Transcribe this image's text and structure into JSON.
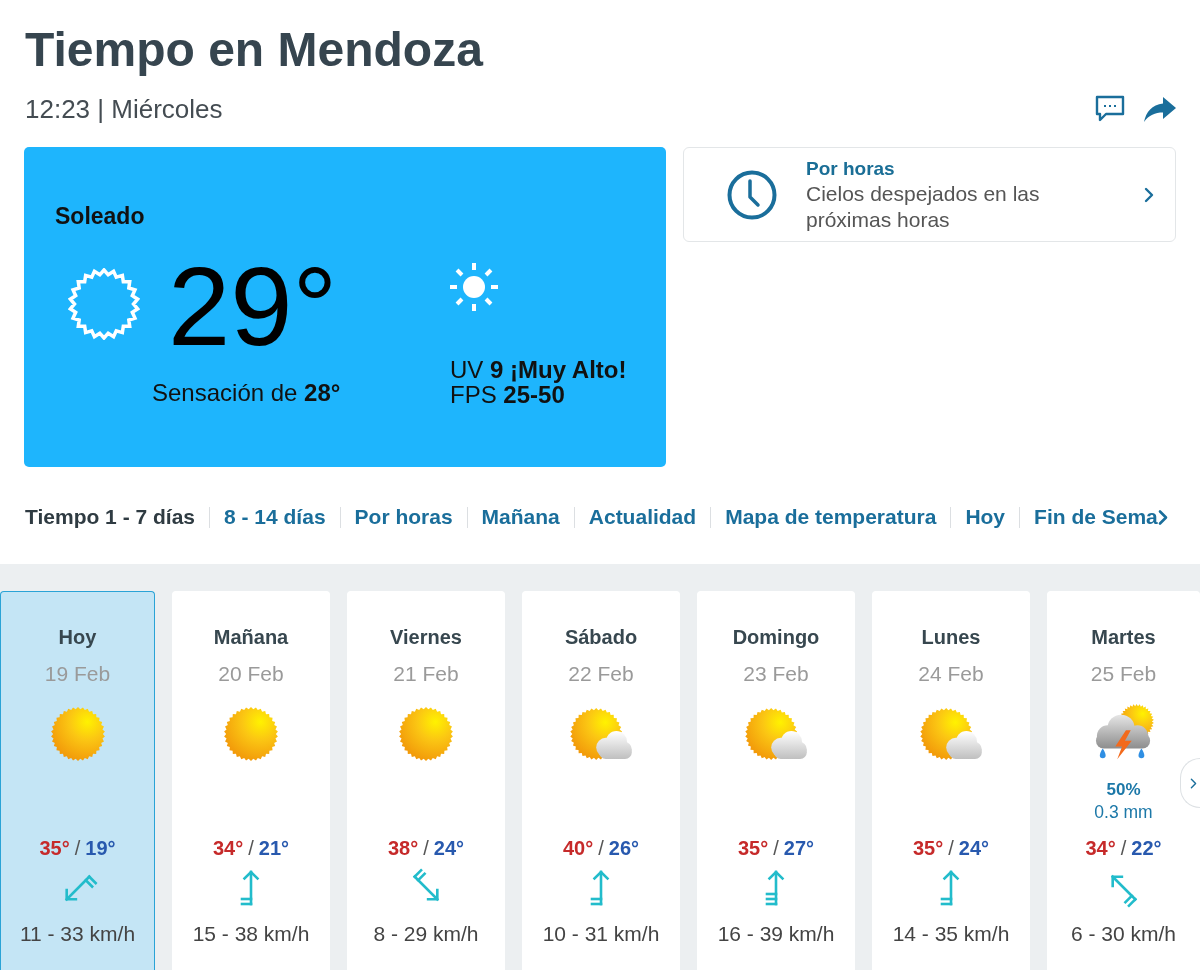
{
  "header": {
    "title": "Tiempo en Mendoza",
    "subtitle": "12:23 | Miércoles"
  },
  "current": {
    "condition": "Soleado",
    "temperature": "29°",
    "feels_like": "Sensación de **28°**",
    "uv": "UV **9 ¡Muy Alto!**",
    "fps": "FPS **25-50**"
  },
  "hourly_card": {
    "title": "Por horas",
    "text": "Cielos despejados en las próximas horas"
  },
  "nav_tabs": [
    {
      "label": "Tiempo 1 - 7 días",
      "selected": true
    },
    {
      "label": "8 - 14 días",
      "selected": false
    },
    {
      "label": "Por horas",
      "selected": false
    },
    {
      "label": "Mañana",
      "selected": false
    },
    {
      "label": "Actualidad",
      "selected": false
    },
    {
      "label": "Mapa de temperatura",
      "selected": false
    },
    {
      "label": "Hoy",
      "selected": false
    },
    {
      "label": "Fin de Sema",
      "selected": false
    }
  ],
  "days": [
    {
      "day": "Hoy",
      "date": "19 Feb",
      "kind": "sunny",
      "max": "35°",
      "separator": "/",
      "min": "19°",
      "wind_arrow": {
        "kind": "southwest",
        "strong": false
      },
      "wind": "11 - 33 km/h",
      "selected": true
    },
    {
      "day": "Mañana",
      "date": "20 Feb",
      "kind": "sunny",
      "max": "34°",
      "separator": "/",
      "min": "21°",
      "wind_arrow": {
        "kind": "north",
        "strong": false
      },
      "wind": "15 - 38 km/h",
      "selected": false
    },
    {
      "day": "Viernes",
      "date": "21 Feb",
      "kind": "sunny",
      "max": "38°",
      "separator": "/",
      "min": "24°",
      "wind_arrow": {
        "kind": "southeast",
        "strong": false
      },
      "wind": "8 - 29 km/h",
      "selected": false
    },
    {
      "day": "Sábado",
      "date": "22 Feb",
      "kind": "cloudy",
      "max": "40°",
      "separator": "/",
      "min": "26°",
      "wind_arrow": {
        "kind": "north",
        "strong": false
      },
      "wind": "10 - 31 km/h",
      "selected": false
    },
    {
      "day": "Domingo",
      "date": "23 Feb",
      "kind": "cloudy",
      "max": "35°",
      "separator": "/",
      "min": "27°",
      "wind_arrow": {
        "kind": "north",
        "strong": true
      },
      "wind": "16 - 39 km/h",
      "selected": false
    },
    {
      "day": "Lunes",
      "date": "24 Feb",
      "kind": "cloudy",
      "max": "35°",
      "separator": "/",
      "min": "24°",
      "wind_arrow": {
        "kind": "north",
        "strong": false
      },
      "wind": "14 - 35 km/h",
      "selected": false
    },
    {
      "day": "Martes",
      "date": "25 Feb",
      "kind": "stormy",
      "rain_chance": "50%",
      "rain_amount": "0.3 mm",
      "max": "34°",
      "separator": "/",
      "min": "22°",
      "wind_arrow": {
        "kind": "northwest",
        "strong": false
      },
      "wind": "6 - 30 km/h",
      "selected": false
    }
  ]
}
